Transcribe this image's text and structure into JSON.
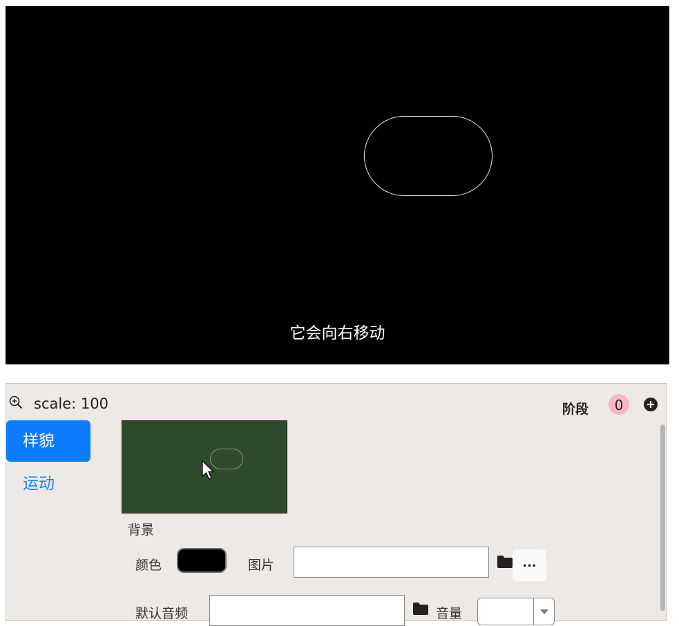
{
  "stage": {
    "caption": "它会向右移动",
    "background": "#000000"
  },
  "toolbar": {
    "zoom_icon": "zoom-in-icon",
    "scale_text": "scale: 100",
    "stage_label": "阶段",
    "stage_count": "0",
    "add_icon": "add-circle-icon"
  },
  "tabs": [
    {
      "label": "样貌",
      "active": true
    },
    {
      "label": "运动",
      "active": false
    }
  ],
  "background_section": {
    "label": "背景",
    "thumb_color": "#2d4a2b"
  },
  "form": {
    "color_label": "颜色",
    "color_value": "#000000",
    "image_label": "图片",
    "image_value": "",
    "more_label": "...",
    "audio_label": "默认音频",
    "audio_value": "",
    "volume_label": "音量",
    "volume_value": "",
    "folder_icon": "folder-icon"
  },
  "colors": {
    "accent": "#0d7bff",
    "panel_bg": "#ece9e6",
    "badge": "#f7b6c2"
  }
}
